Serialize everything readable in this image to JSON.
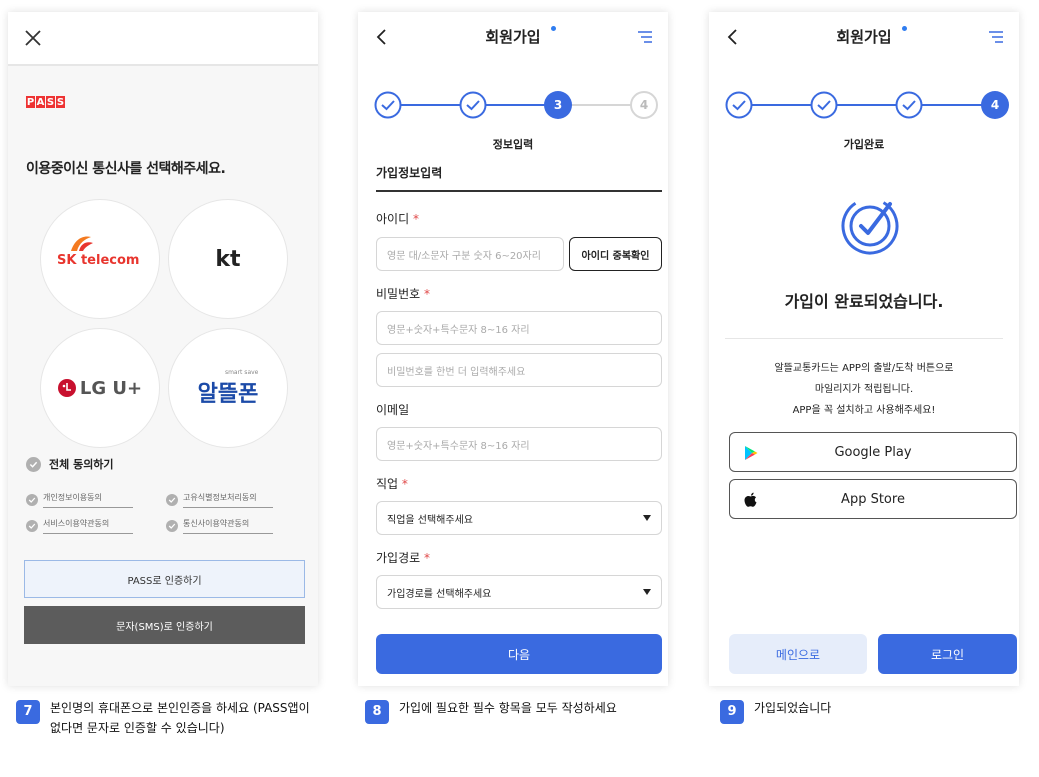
{
  "panel1": {
    "pass_logo": [
      "P",
      "A",
      "S",
      "S"
    ],
    "title": "이용중이신 통신사를 선택해주세요.",
    "carriers": {
      "sk": "SK telecom",
      "kt": "kt",
      "lgu": "LG U+",
      "altteul_small": "smart save",
      "altteul": "알뜰폰"
    },
    "agree_all": "전체 동의하기",
    "agree_items": [
      "개인정보이용동의",
      "고유식별정보처리동의",
      "서비스이용약관동의",
      "통신사이용약관동의"
    ],
    "pass_button": "PASS로 인증하기",
    "sms_button": "문자(SMS)로 인증하기"
  },
  "panel2": {
    "title": "회원가입",
    "steps": [
      "3",
      "4"
    ],
    "step_label": "정보입력",
    "section": "가입정보입력",
    "id_label": "아이디",
    "required": "*",
    "id_placeholder": "영문 대/소문자 구분 숫자 6~20자리",
    "id_check": "아이디 중복확인",
    "pw_label": "비밀번호",
    "pw_placeholder": "영문+숫자+특수문자 8~16 자리",
    "pw_confirm_placeholder": "비밀번호를 한번 더 입력해주세요",
    "email_label": "이메일",
    "email_placeholder": "영문+숫자+특수문자 8~16 자리",
    "job_label": "직업",
    "job_value": "직업을 선택해주세요",
    "route_label": "가입경로",
    "route_value": "가입경로를 선택해주세요",
    "next_button": "다음"
  },
  "panel3": {
    "title": "회원가입",
    "steps": [
      "4"
    ],
    "step_label": "가입완료",
    "done_title": "가입이 완료되었습니다.",
    "desc_lines": [
      "알뜰교통카드는 APP의 출발/도착 버튼으로",
      "마일리지가 적립됩니다.",
      "APP을 꼭 설치하고 사용해주세요!"
    ],
    "google_play": "Google Play",
    "app_store": "App Store",
    "main_button": "메인으로",
    "login_button": "로그인"
  },
  "captions": [
    {
      "num": "7",
      "text": "본인명의 휴대폰으로 본인인증을 하세요 (PASS앱이 없다면 문자로 인증할 수 있습니다)"
    },
    {
      "num": "8",
      "text": "가입에 필요한 필수 항목을 모두 작성하세요"
    },
    {
      "num": "9",
      "text": "가입되었습니다"
    }
  ],
  "colors": {
    "accent": "#3a6ae0",
    "pass_red": "#e33333",
    "sk_red": "#e8352e",
    "lg_red": "#c8102e",
    "altteul_blue": "#1b4aa8"
  }
}
